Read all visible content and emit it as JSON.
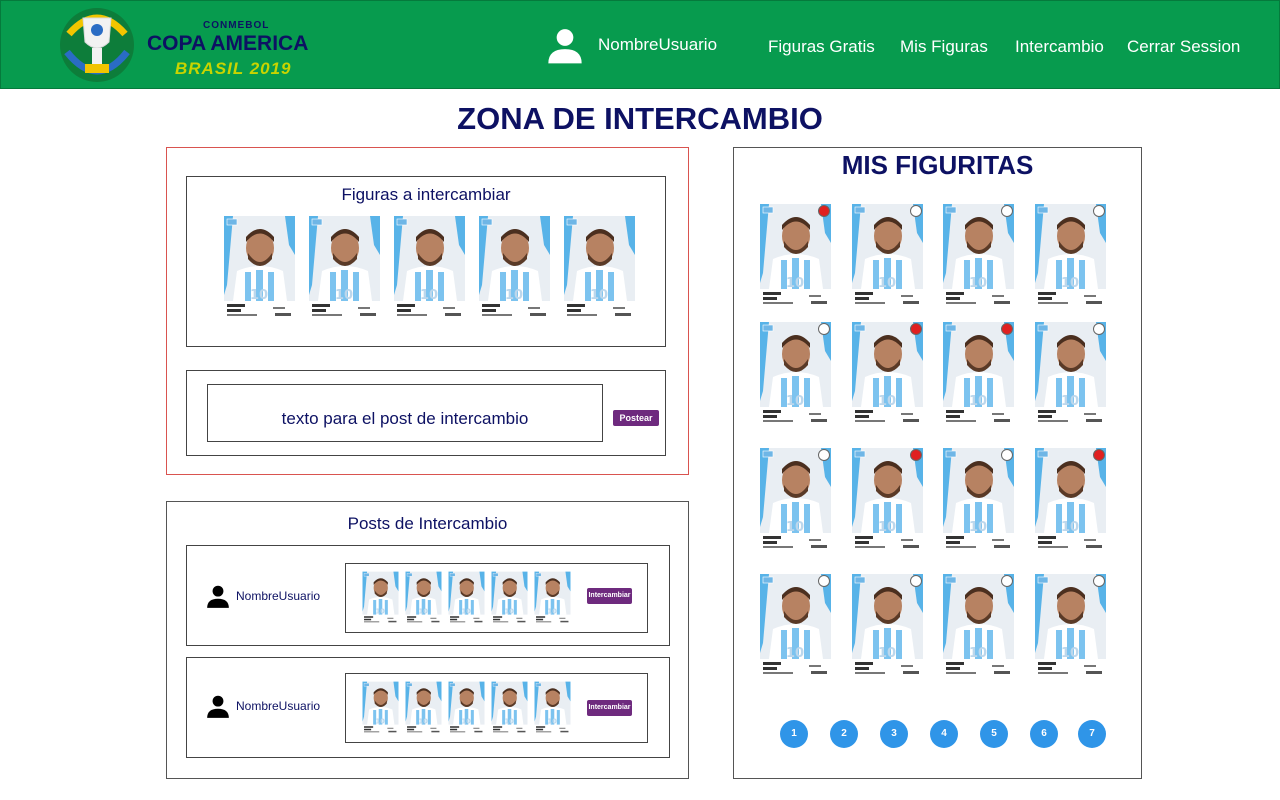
{
  "header": {
    "logo_text_small": "CONMEBOL",
    "logo_text_main": "COPA AMERICA",
    "logo_text_sub": "BRASIL 2019",
    "user_name": "NombreUsuario",
    "nav": [
      "Figuras Gratis",
      "Mis Figuras",
      "Intercambio",
      "Cerrar Session"
    ]
  },
  "page_title": "ZONA DE INTERCAMBIO",
  "exchange": {
    "title": "Figuras a intercambiar",
    "post_placeholder": "texto para el post de intercambio",
    "post_button": "Postear"
  },
  "posts": {
    "title": "Posts de Intercambio",
    "items": [
      {
        "user": "NombreUsuario",
        "button": "Intercambiar"
      },
      {
        "user": "NombreUsuario",
        "button": "Intercambiar"
      }
    ]
  },
  "my_stickers": {
    "title": "MIS FIGURITAS",
    "indicators": [
      "red",
      "white",
      "white",
      "white",
      "white",
      "red",
      "red",
      "white",
      "white",
      "red",
      "white",
      "red",
      "white",
      "white",
      "white",
      "white"
    ],
    "pages": [
      "1",
      "2",
      "3",
      "4",
      "5",
      "6",
      "7"
    ]
  },
  "colors": {
    "header_bg": "#079b4e",
    "title": "#0d1163",
    "button_purple": "#6e2a7e",
    "page_button": "#2f95e8",
    "indicator_red": "#e02020",
    "indicator_green": "#2e9b3a"
  }
}
